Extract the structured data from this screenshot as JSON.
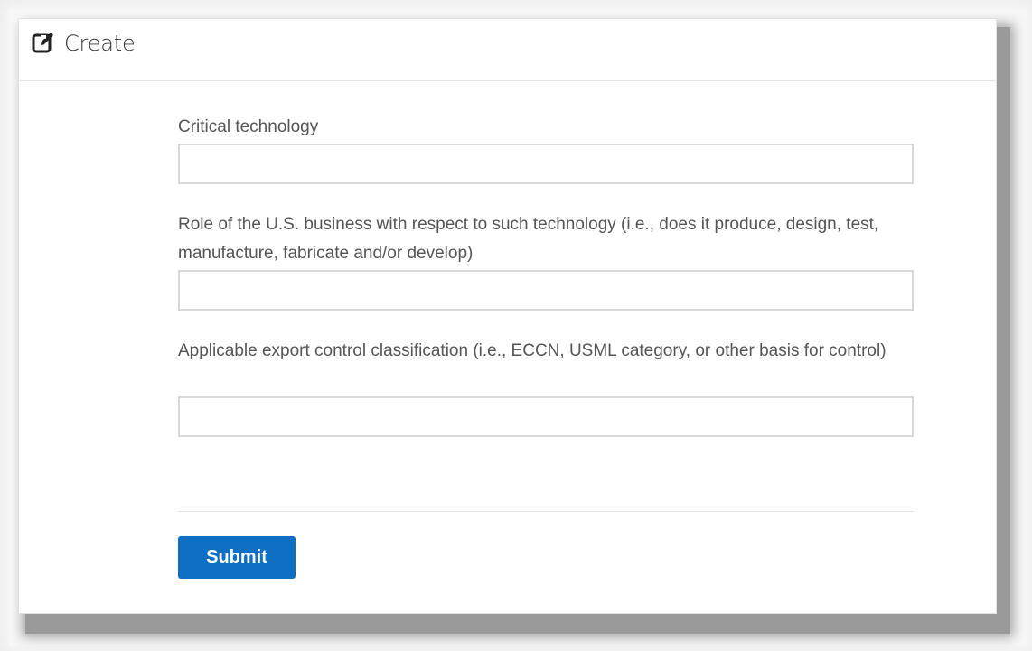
{
  "header": {
    "title": "Create",
    "icon": "edit-icon"
  },
  "form": {
    "fields": [
      {
        "label": "Critical technology",
        "value": "",
        "placeholder": ""
      },
      {
        "label": "Role of the U.S. business with respect to such technology (i.e., does it produce, design, test, manufacture, fabricate and/or develop)",
        "value": "",
        "placeholder": ""
      },
      {
        "label": "Applicable export control classification (i.e., ECCN, USML category, or other basis for control)",
        "value": "",
        "placeholder": ""
      }
    ],
    "submit_label": "Submit"
  },
  "colors": {
    "accent": "#0f6fc5",
    "label_text": "#555555",
    "input_border": "#d9d9d9"
  }
}
